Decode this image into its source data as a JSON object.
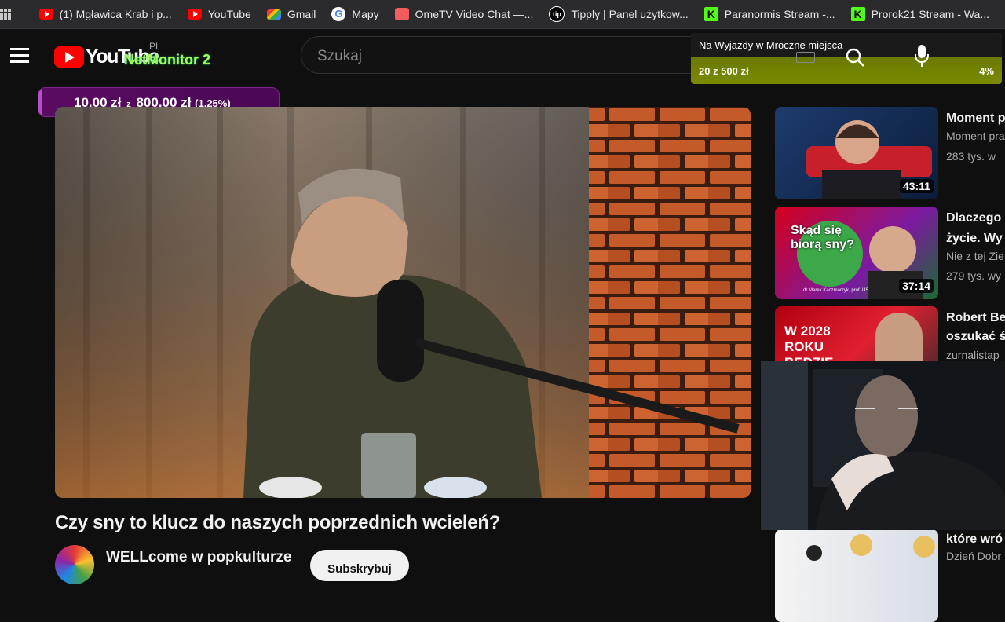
{
  "bookmarks": [
    {
      "label": "(1) Mgławica Krab i p...",
      "icon": "youtube-icon"
    },
    {
      "label": "YouTube",
      "icon": "youtube-icon"
    },
    {
      "label": "Gmail",
      "icon": "gmail-icon"
    },
    {
      "label": "Mapy",
      "icon": "google-icon"
    },
    {
      "label": "OmeTV Video Chat —...",
      "icon": "ometv-icon"
    },
    {
      "label": "Tipply | Panel użytkow...",
      "icon": "tipply-icon"
    },
    {
      "label": "Paranormis Stream -...",
      "icon": "kick-icon"
    },
    {
      "label": "Prorok21 Stream - Wa...",
      "icon": "kick-icon"
    }
  ],
  "header": {
    "logo_text": "YouTube",
    "logo_region": "PL",
    "overlay_brand": "NetMonitor 2",
    "search_placeholder": "Szukaj"
  },
  "goal_widget": {
    "title": "Na Wyjazdy w Mroczne miejsca",
    "amount": "20 z 500 zł",
    "percent": "4%",
    "progress": 0.04
  },
  "donation_bar": {
    "current": "10,00 zł",
    "separator": "z",
    "target": "800,00 zł",
    "percent": "(1.25%)",
    "progress": 0.0125
  },
  "video": {
    "title": "Czy sny to klucz do naszych poprzednich wcieleń?",
    "channel": "WELLcome w popkulturze",
    "subscribe_label": "Subskrybuj"
  },
  "recommendations": [
    {
      "title": "Moment p",
      "line2": "",
      "channel": "Moment pra",
      "views": "283 tys. w",
      "duration": "43:11"
    },
    {
      "title": "Dlaczego",
      "line2": "życie. Wy",
      "channel": "Nie z tej Zie",
      "views": "279 tys. wy",
      "duration": "37:14"
    },
    {
      "title": "Robert Be",
      "line2": "oszukać ś",
      "channel": "zurnalistap",
      "views": "",
      "duration": ""
    },
    {
      "title": "które wró",
      "line2": "",
      "channel": "Dzień Dobr",
      "views": "",
      "duration": ""
    }
  ],
  "thumb_texts": {
    "t2_main": "Skąd się biorą sny?",
    "t2_sub": "dr Marek Kaczmarzyk, prof. UŚ",
    "t3_main": "W 2028 ROKU BĘDZIE KONIEC"
  },
  "colors": {
    "background": "#0f0f0f",
    "youtube_red": "#ff0000",
    "goal_bar": "#7a8a00",
    "donation_bar": "#5a0b63"
  }
}
